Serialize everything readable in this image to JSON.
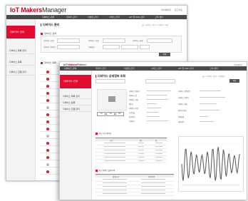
{
  "back_window": {
    "logo_brand": "IoT Makers",
    "logo_sub": "Manager",
    "top_links": [
      "마이페이지",
      "로그아웃"
    ],
    "menu": [
      "디바이스 관리",
      "데이터 관리",
      "이벤트 관리",
      "서비스 관리",
      "API 및 SDK 관리",
      "고객 센터"
    ],
    "sidebar_title": "디바이스 관리",
    "sidebar_items": [
      "디바이스 목록 관리",
      "디바이스 등록",
      "디바이스 모델 관리"
    ],
    "page_title": "디바이스 관리",
    "breadcrumb": "홈 > 디바이스 관리 > 디바이스 목록",
    "search_section": "디바이스 검색",
    "filters": [
      "디바이스 유형",
      "디바이스 모델",
      "디바이스 상태",
      "디바이스 아이디",
      "등록일시"
    ],
    "search_button": "검색",
    "list_section": "디바이스 목록"
  },
  "front_window": {
    "logo_brand": "IoT Makers",
    "logo_sub": "Platform",
    "top_links": [
      "마이페이지"
    ],
    "menu": [
      "디바이스 관리",
      "데이터 관리",
      "이벤트 관리",
      "서비스 관리",
      "API 및 SDK 관리",
      "고객 센터"
    ],
    "sidebar_title": "디바이스 관리",
    "sidebar_items": [
      "디바이스 목록 관리",
      "디바이스 등록",
      "디바이스 모델 관리"
    ],
    "page_title": "디바이스 상세정보 조회",
    "breadcrumb": "홈 > 디바이스 관리 > 상세정보",
    "list_button": "목록",
    "detail_labels": [
      "디바이스 아이디",
      "디바이스 명",
      "디바이스 모델",
      "제조사",
      "디바이스 유형",
      "프로토콜",
      "통신방식",
      "등록일시"
    ],
    "detail_labels_right": [
      "디바이스 인증방법",
      "디바이스 인증키",
      "디바이스 상태",
      "최종수신일시",
      "연결상태",
      "제어이력"
    ],
    "action_buttons": [
      "수정",
      "삭제",
      "제어"
    ],
    "section1_title": "최근 수집 데이터",
    "table1_headers": [
      "시간",
      "태그",
      "값"
    ],
    "section2_title": "최근 이벤트 발생 이력",
    "table2_headers": [
      "발생시간",
      "이벤트명"
    ]
  },
  "colors": {
    "accent": "#e30b2f",
    "menu_bg": "#4a4a4a",
    "chart_line": "#555555"
  }
}
